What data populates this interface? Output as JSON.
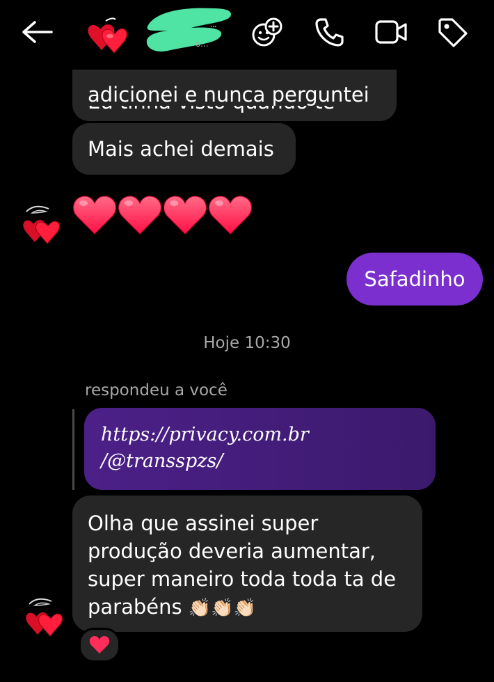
{
  "header": {
    "back_icon": "arrow-left-icon",
    "contact_avatar": "hearts-avatar",
    "contact_name_hidden_dots": "...",
    "contact_status_hidden_dots": "o...",
    "actions": [
      "gif-sticker-icon",
      "phone-icon",
      "video-icon",
      "tag-icon"
    ]
  },
  "messages": {
    "m1": "adicionei e nunca perguntei",
    "m1_cut": "Eu tinha visto quando te",
    "m2": "Mais achei demais",
    "m3_hearts_count": 4,
    "m4": "Safadinho",
    "timestamp": "Hoje 10:30",
    "reply_label": "respondeu a você",
    "quoted_line1": "https://privacy.com.br",
    "quoted_line2": "/@transspzs/",
    "m5_line1": "Olha que assinei super",
    "m5_line2": "produção deveria aumentar,",
    "m5_line3": "super maneiro toda toda ta de",
    "m5_line4": "parabéns",
    "m5_emoji": "👏🏻👏🏻👏🏻",
    "reaction": "❤"
  },
  "colors": {
    "background": "#000000",
    "incoming_bubble": "#262626",
    "outgoing_bubble": "#7a2fce",
    "quoted_bubble": "#4c2088",
    "muted_text": "#a8a8a8",
    "heart": "#ff2d5a"
  }
}
